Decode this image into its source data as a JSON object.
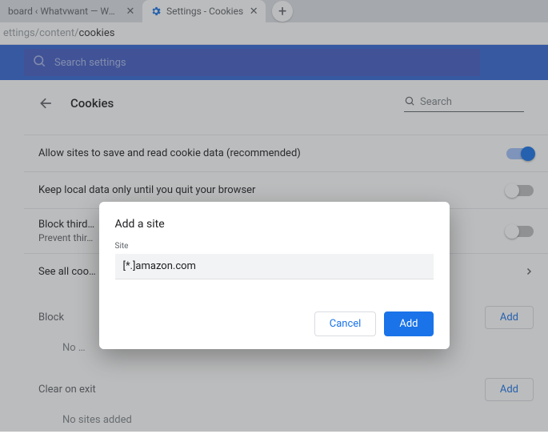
{
  "tabs": {
    "t0": {
      "title": "board ‹ Whatvwant — Wor…"
    },
    "t1": {
      "title": "Settings - Cookies"
    }
  },
  "url": {
    "grey": "ettings/content/",
    "rest": "cookies"
  },
  "header": {
    "search_placeholder": "Search settings"
  },
  "page": {
    "title": "Cookies",
    "search_placeholder": "Search",
    "row_allow": "Allow sites to save and read cookie data (recommended)",
    "row_keep": "Keep local data only until you quit your browser",
    "row_third": "Block third…",
    "row_third_sub": "Prevent thir…",
    "row_all": "See all coo…",
    "block_hdr": "Block",
    "block_empty": "No …",
    "clear_hdr": "Clear on exit",
    "clear_empty": "No sites added",
    "add_btn": "Add"
  },
  "dialog": {
    "title": "Add a site",
    "field_label": "Site",
    "field_value": "[*.]amazon.com",
    "cancel": "Cancel",
    "add": "Add"
  }
}
